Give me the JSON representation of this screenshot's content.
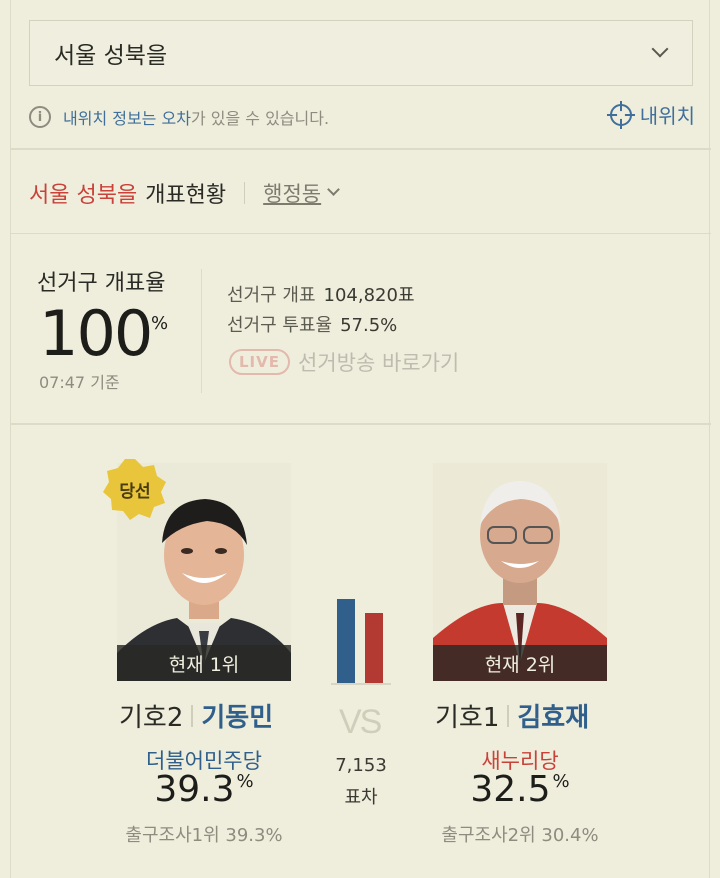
{
  "selector": {
    "value": "서울 성북을"
  },
  "notice": {
    "part1": "내위치 정보는 오차",
    "part2": "가 있을 수 있습니다."
  },
  "my_location": {
    "label": "내위치"
  },
  "header": {
    "region": "서울 성북을",
    "label": "개표현황",
    "sub": "행정동"
  },
  "stats": {
    "rate_label": "선거구 개표율",
    "rate_value": "100",
    "rate_unit": "%",
    "time": "07:47 기준",
    "count_label": "선거구 개표",
    "count_value": "104,820표",
    "turnout_label": "선거구 투표율",
    "turnout_value": "57.5%",
    "live_badge": "LIVE",
    "live_label": "선거방송 바로가기"
  },
  "candidates": [
    {
      "rank": "현재 1위",
      "badge": "당선",
      "number": "기호2",
      "name": "기동민",
      "party": "더불어민주당",
      "party_color": "#2f5f8a",
      "pct": "39.3",
      "pct_unit": "%",
      "exit_poll": "출구조사1위 39.3%",
      "vote_share": 39.3
    },
    {
      "rank": "현재 2위",
      "number": "기호1",
      "name": "김효재",
      "party": "새누리당",
      "party_color": "#c8423a",
      "pct": "32.5",
      "pct_unit": "%",
      "exit_poll": "출구조사2위 30.4%",
      "vote_share": 32.5
    }
  ],
  "comparison": {
    "vs": "VS",
    "gap": "7,153",
    "gap_label": "표차",
    "bar_colors": [
      "#2f5f8a",
      "#b23a33"
    ]
  }
}
